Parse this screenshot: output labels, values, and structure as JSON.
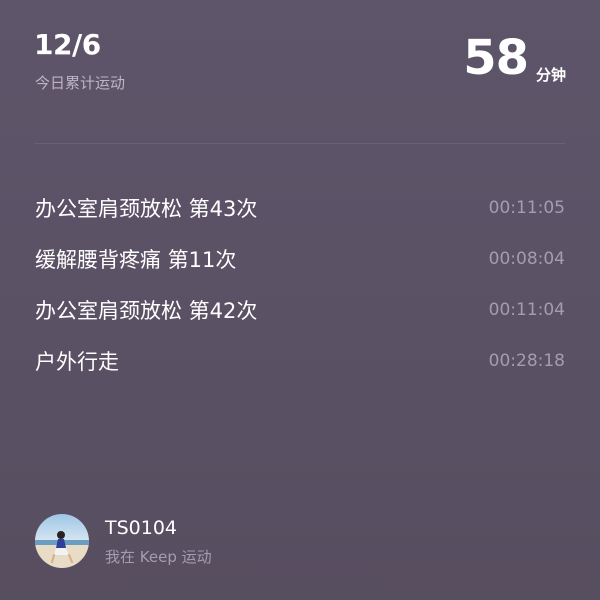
{
  "header": {
    "date": "12/6",
    "subtitle": "今日累计运动",
    "total_minutes": "58",
    "unit": "分钟"
  },
  "activities": [
    {
      "title": "办公室肩颈放松 第43次",
      "duration": "00:11:05"
    },
    {
      "title": "缓解腰背疼痛 第11次",
      "duration": "00:08:04"
    },
    {
      "title": "办公室肩颈放松 第42次",
      "duration": "00:11:04"
    },
    {
      "title": "户外行走",
      "duration": "00:28:18"
    }
  ],
  "profile": {
    "username": "TS0104",
    "slogan": "我在 Keep 运动"
  }
}
